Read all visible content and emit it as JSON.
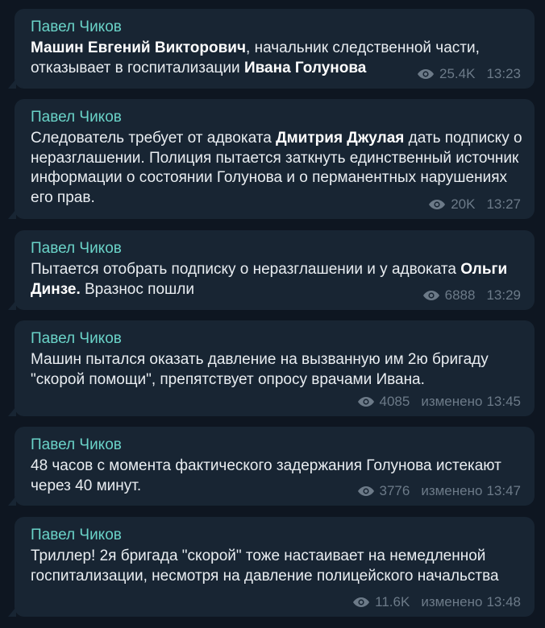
{
  "messages": [
    {
      "author": "Павел Чиков",
      "parts": [
        {
          "t": "Машин Евгений Викторович",
          "b": true
        },
        {
          "t": ", начальник следственной части, отказывает в госпитализации "
        },
        {
          "t": "Ивана Голунова",
          "b": true
        }
      ],
      "views": "25.4K",
      "edited": "",
      "time": "13:23"
    },
    {
      "author": "Павел Чиков",
      "parts": [
        {
          "t": "Следователь требует от адвоката "
        },
        {
          "t": "Дмитрия Джулая",
          "b": true
        },
        {
          "t": " дать подписку о неразглашении. Полиция пытается заткнуть единственный источник информации о состоянии Голунова и о перманентных нарушениях его прав."
        }
      ],
      "views": "20K",
      "edited": "",
      "time": "13:27"
    },
    {
      "author": "Павел Чиков",
      "parts": [
        {
          "t": "Пытается отобрать подписку о неразглашении и у адвоката "
        },
        {
          "t": "Ольги Динзе.",
          "b": true
        },
        {
          "t": " Вразнос пошли"
        }
      ],
      "views": "6888",
      "edited": "",
      "time": "13:29"
    },
    {
      "author": "Павел Чиков",
      "parts": [
        {
          "t": "Машин пытался оказать давление на вызванную им 2ю бригаду \"скорой помощи\", препятствует опросу врачами Ивана."
        }
      ],
      "views": "4085",
      "edited": "изменено",
      "time": "13:45"
    },
    {
      "author": "Павел Чиков",
      "parts": [
        {
          "t": "48 часов с момента фактического задержания Голунова истекают через 40 минут."
        }
      ],
      "views": "3776",
      "edited": "изменено",
      "time": "13:47"
    },
    {
      "author": "Павел Чиков",
      "parts": [
        {
          "t": "Триллер! 2я бригада \"скорой\" тоже настаивает на немедленной госпитализации, несмотря на давление полицейского начальства"
        }
      ],
      "views": "11.6K",
      "edited": "изменено",
      "time": "13:48"
    }
  ],
  "colors": {
    "background": "#0e1621",
    "bubble": "#182533",
    "author": "#6ad3c8",
    "text": "#e9edf1",
    "meta": "#6c7a88"
  },
  "icons": {
    "views": "eye-icon"
  }
}
